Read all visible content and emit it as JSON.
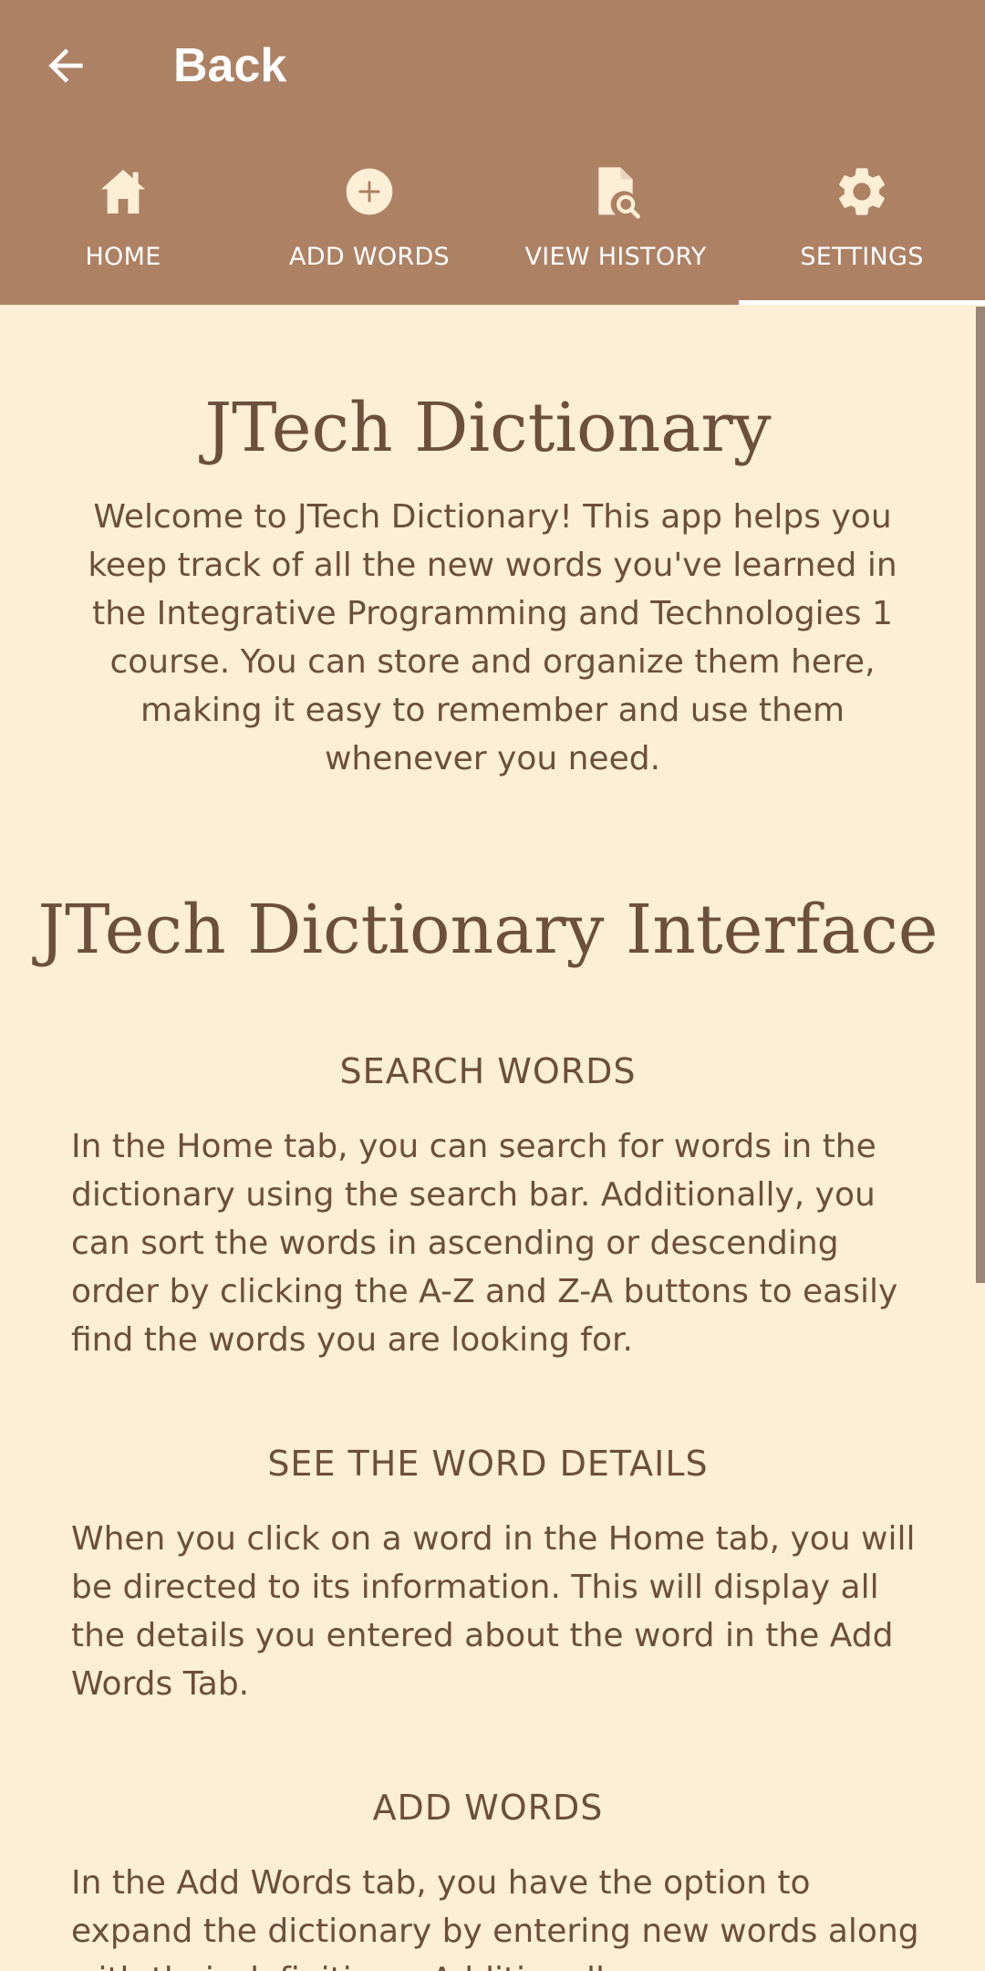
{
  "header": {
    "back_label": "Back",
    "back_icon": "arrow-left-icon"
  },
  "tabs": [
    {
      "label": "HOME",
      "icon": "home-icon"
    },
    {
      "label": "ADD WORDS",
      "icon": "plus-circle-icon"
    },
    {
      "label": "VIEW HISTORY",
      "icon": "document-search-icon"
    },
    {
      "label": "SETTINGS",
      "icon": "gear-icon",
      "selected": true
    }
  ],
  "page": {
    "title": "JTech Dictionary",
    "intro": "Welcome to JTech Dictionary! This app helps you keep track of all the new words you've learned in the Integrative Programming and Technologies 1 course. You can store and organize them here, making it easy to remember and use them whenever you need.",
    "interface_title": "JTech Dictionary Interface",
    "sections": [
      {
        "heading": "SEARCH WORDS",
        "body": "In the Home tab, you can search for words in the dictionary using the search bar. Additionally, you can sort the words in ascending or descending order by clicking the A-Z and Z-A buttons to easily find the words you are looking for."
      },
      {
        "heading": "SEE THE WORD DETAILS",
        "body": "When you click on a word in the Home tab, you will be directed to its information. This will display all the details you entered about the word in the Add Words Tab."
      },
      {
        "heading": "ADD WORDS",
        "body": "In the Add Words tab, you have the option to expand the dictionary by entering new words along with their definitions. Additionally,"
      }
    ]
  },
  "colors": {
    "header_bg": "#ad8164",
    "page_bg": "#fcefd6",
    "text": "#6c4f3c",
    "indicator": "#ffffff"
  }
}
